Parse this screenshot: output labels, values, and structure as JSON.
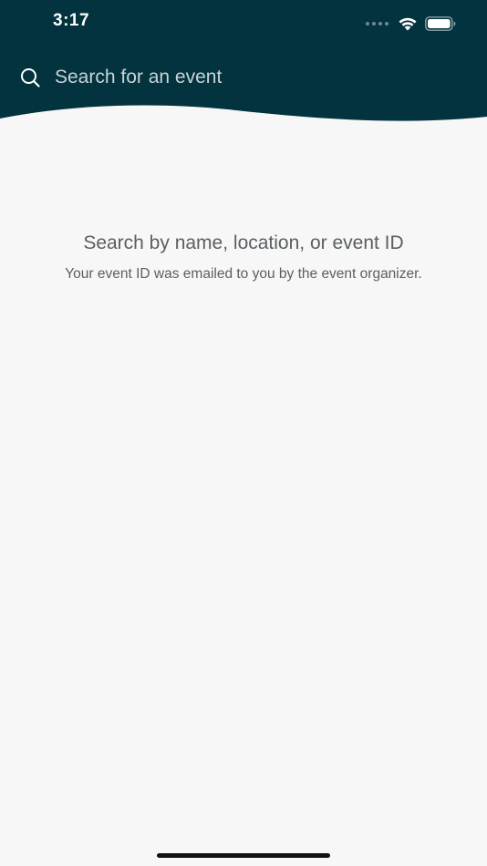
{
  "status_bar": {
    "time": "3:17"
  },
  "search": {
    "placeholder": "Search for an event",
    "value": ""
  },
  "empty_state": {
    "title": "Search by name, location, or event ID",
    "subtitle": "Your event ID was emailed to you by the event organizer."
  },
  "icons": {
    "search": "search-icon",
    "wifi": "wifi-icon",
    "battery": "battery-icon",
    "signal": "signal-icon"
  },
  "colors": {
    "header_bg": "#02333f",
    "page_bg": "#f7f7f7",
    "text_muted": "#5a5f63",
    "status_text": "#ffffff"
  }
}
